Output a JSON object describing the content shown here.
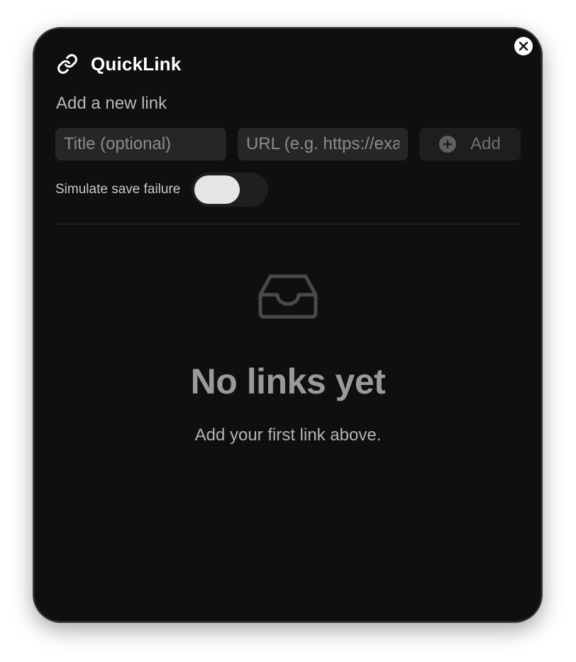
{
  "app": {
    "title": "QuickLink"
  },
  "form": {
    "section_label": "Add a new link",
    "title_placeholder": "Title (optional)",
    "url_placeholder": "URL (e.g. https://example.com)",
    "add_label": "Add",
    "toggle_label": "Simulate save failure",
    "toggle_on": false
  },
  "empty_state": {
    "title": "No links yet",
    "subtitle": "Add your first link above."
  },
  "icons": {
    "logo": "link-icon",
    "close": "close-icon",
    "add": "plus-circle-icon",
    "empty": "inbox-icon"
  },
  "colors": {
    "background": "#0f0f0f",
    "input": "#262626",
    "text_primary": "#ffffff",
    "text_muted": "#9a9a9a"
  }
}
